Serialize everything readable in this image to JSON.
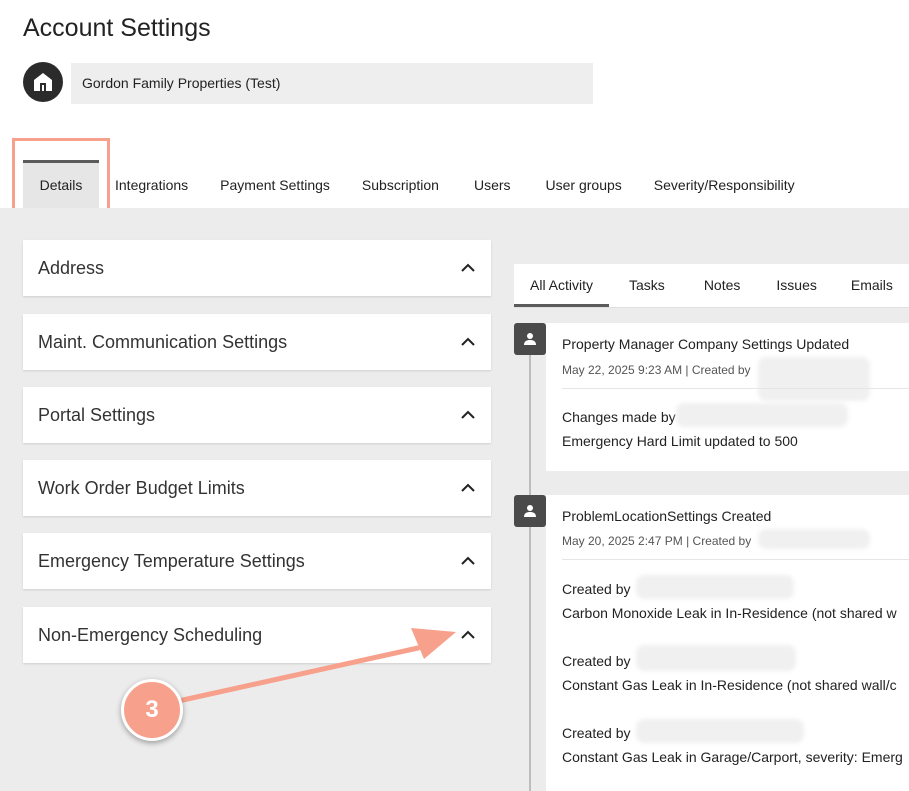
{
  "header": {
    "title": "Account Settings",
    "account_name": "Gordon Family Properties (Test)",
    "logo_icon": "home-icon"
  },
  "tabs": [
    {
      "label": "Details",
      "active": true
    },
    {
      "label": "Integrations"
    },
    {
      "label": "Payment Settings"
    },
    {
      "label": "Subscription"
    },
    {
      "label": "Users"
    },
    {
      "label": "User groups"
    },
    {
      "label": "Severity/Responsibility"
    }
  ],
  "panels": [
    {
      "label": "Address"
    },
    {
      "label": "Maint. Communication Settings"
    },
    {
      "label": "Portal Settings"
    },
    {
      "label": "Work Order Budget Limits"
    },
    {
      "label": "Emergency Temperature Settings"
    },
    {
      "label": "Non-Emergency Scheduling"
    }
  ],
  "activity": {
    "tabs": [
      {
        "label": "All Activity",
        "active": true
      },
      {
        "label": "Tasks"
      },
      {
        "label": "Notes"
      },
      {
        "label": "Issues"
      },
      {
        "label": "Emails"
      }
    ],
    "entries": [
      {
        "title": "Property Manager Company Settings Updated",
        "meta": "May 22, 2025 9:23 AM | Created by",
        "lines": [
          "Changes made by",
          "Emergency Hard Limit updated to 500"
        ]
      },
      {
        "title": "ProblemLocationSettings Created",
        "meta": "May 20, 2025 2:47 PM | Created by",
        "lines": [
          "Created by",
          "Carbon Monoxide Leak in In-Residence (not shared w",
          "Created by",
          "Constant Gas Leak in In-Residence (not shared wall/c",
          "Created by",
          "Constant Gas Leak in Garage/Carport, severity: Emerg"
        ]
      }
    ]
  },
  "annotation": {
    "step_number": "3",
    "color": "#f7a08c"
  },
  "colors": {
    "highlight": "#f7a08c",
    "content_bg": "#ececec",
    "tab_active_bg": "#e6e6e6",
    "icon_dark": "#2b2b2b"
  }
}
